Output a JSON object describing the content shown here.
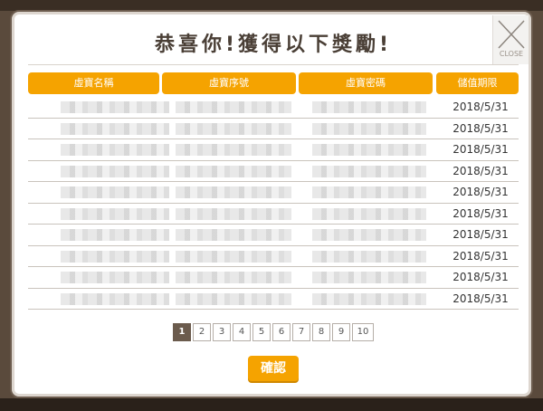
{
  "dialog": {
    "title": "恭喜你!獲得以下獎勵!",
    "close_label": "CLOSE"
  },
  "table": {
    "headers": [
      "虛寶名稱",
      "虛寶序號",
      "虛寶密碼",
      "儲值期限"
    ],
    "rows": [
      {
        "expiry": "2018/5/31"
      },
      {
        "expiry": "2018/5/31"
      },
      {
        "expiry": "2018/5/31"
      },
      {
        "expiry": "2018/5/31"
      },
      {
        "expiry": "2018/5/31"
      },
      {
        "expiry": "2018/5/31"
      },
      {
        "expiry": "2018/5/31"
      },
      {
        "expiry": "2018/5/31"
      },
      {
        "expiry": "2018/5/31"
      },
      {
        "expiry": "2018/5/31"
      }
    ]
  },
  "pagination": {
    "pages": [
      "1",
      "2",
      "3",
      "4",
      "5",
      "6",
      "7",
      "8",
      "9",
      "10"
    ],
    "current": "1"
  },
  "footer": {
    "confirm_label": "確認"
  },
  "colors": {
    "accent": "#f5a300",
    "frame": "#6b5b4d",
    "title_text": "#4a3f36"
  },
  "icons": {
    "close": "close-x-icon"
  }
}
